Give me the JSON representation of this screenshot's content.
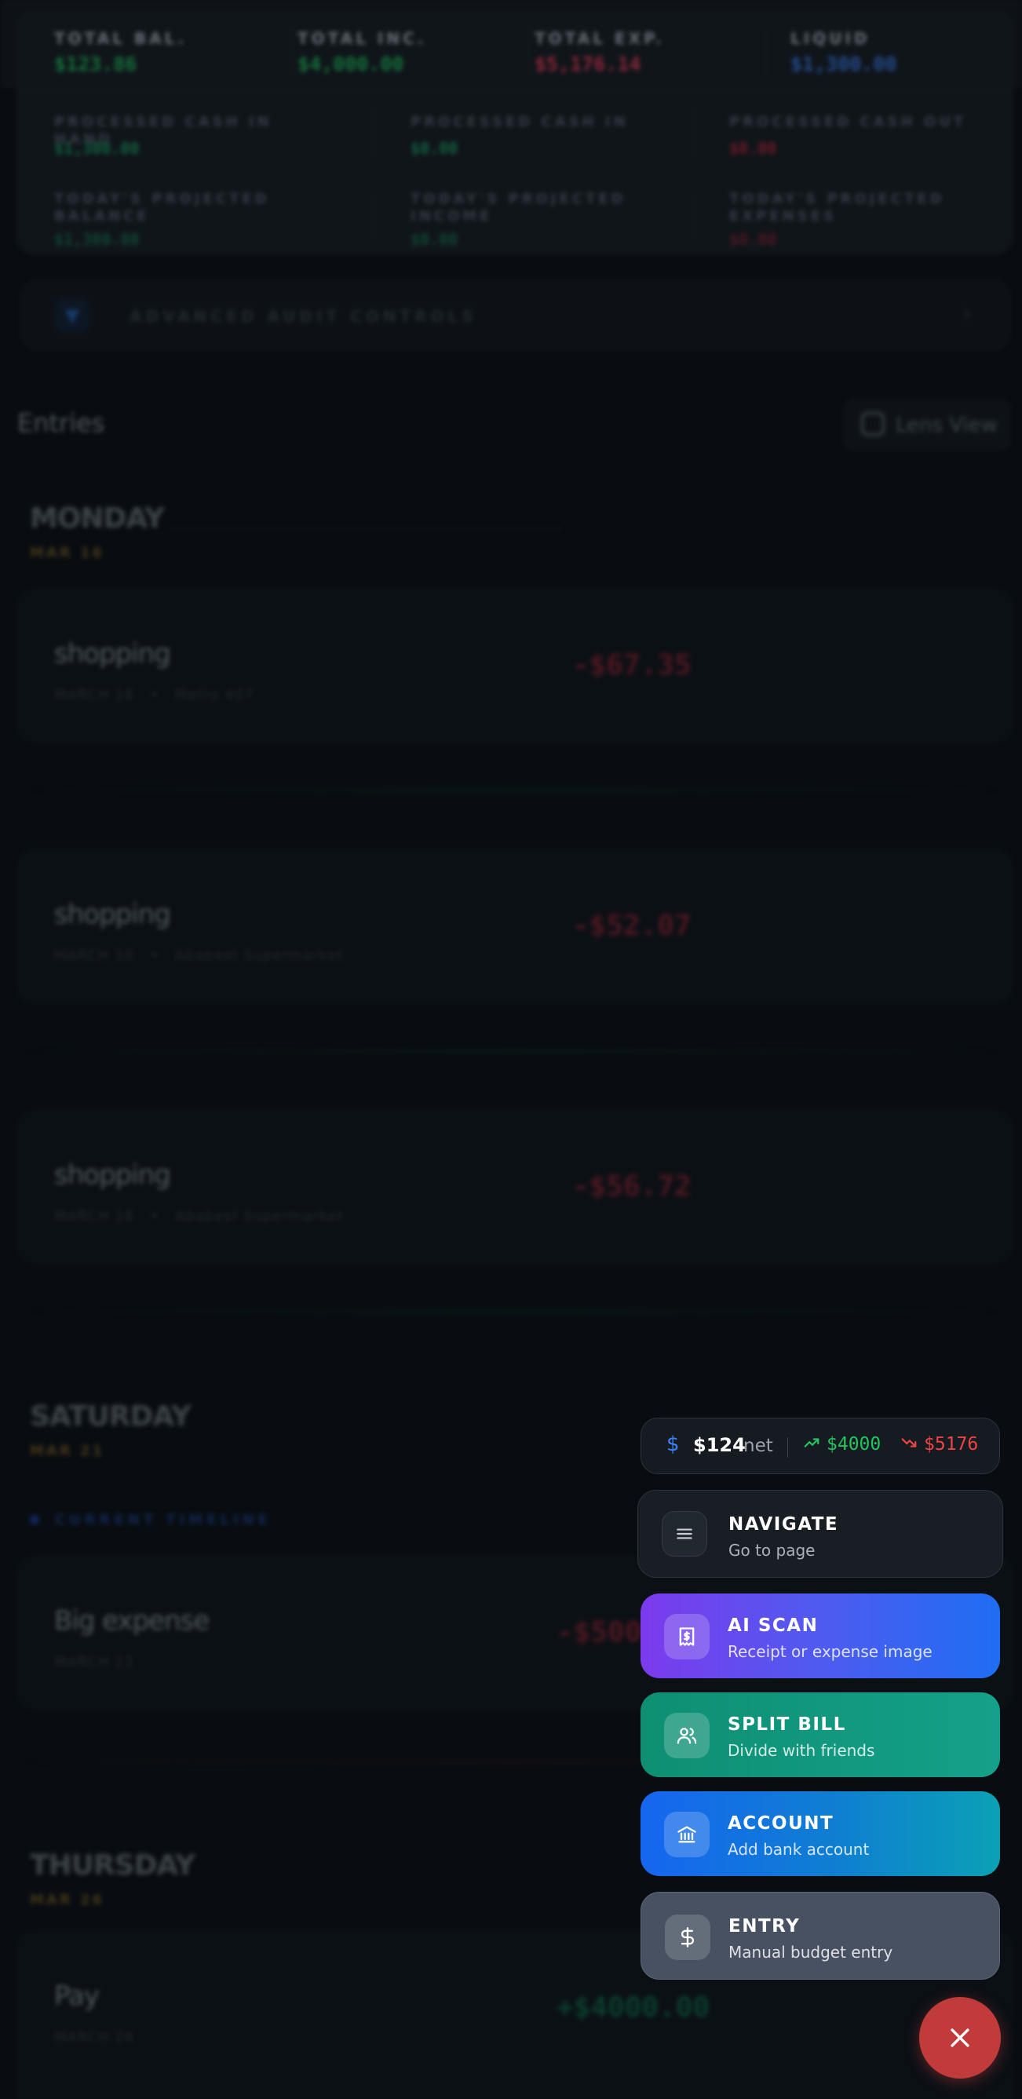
{
  "summary": {
    "row1": [
      {
        "label": "TOTAL BAL.",
        "value": "$123.86",
        "color": "#22c55e"
      },
      {
        "label": "TOTAL INC.",
        "value": "$4,000.00",
        "color": "#22c55e"
      },
      {
        "label": "TOTAL EXP.",
        "value": "$5,176.14",
        "color": "#f43f5e"
      },
      {
        "label": "LIQUID",
        "value": "$1,300.00",
        "color": "#3b82f6"
      }
    ],
    "row2": [
      {
        "label": "PROCESSED CASH IN HAND",
        "value": "$1,300.00",
        "color": "#1fa56a"
      },
      {
        "label": "PROCESSED CASH IN",
        "value": "$0.00",
        "color": "#1fa56a"
      },
      {
        "label": "PROCESSED CASH OUT",
        "value": "$0.00",
        "color": "#c0283d"
      }
    ],
    "row3": [
      {
        "label": "TODAY'S PROJECTED BALANCE",
        "value": "$1,300.00",
        "color": "#1fa56a"
      },
      {
        "label": "TODAY'S PROJECTED INCOME",
        "value": "$0.00",
        "color": "#1fa56a"
      },
      {
        "label": "TODAY'S PROJECTED EXPENSES",
        "value": "$0.00",
        "color": "#c0283d"
      }
    ]
  },
  "audit": {
    "label": "ADVANCED AUDIT CONTROLS"
  },
  "entries": {
    "title": "Entries",
    "lens_label": "Lens View",
    "current_timeline_label": "CURRENT TIMELINE",
    "days": [
      {
        "day": "MONDAY",
        "date": "MAR 16"
      },
      {
        "day": "SATURDAY",
        "date": "MAR 21"
      },
      {
        "day": "THURSDAY",
        "date": "MAR 26"
      }
    ],
    "items": [
      {
        "title": "shopping",
        "date": "MARCH 16",
        "place": "Metro 407",
        "amount": "-$67.35"
      },
      {
        "title": "shopping",
        "date": "MARCH 16",
        "place": "Ababeel Supermarket",
        "amount": "-$52.07"
      },
      {
        "title": "shopping",
        "date": "MARCH 16",
        "place": "Ababeel Supermarket",
        "amount": "-$56.72"
      },
      {
        "title": "Big expense",
        "date": "MARCH 21",
        "place": "",
        "amount": "-$5000"
      },
      {
        "title": "Pay",
        "date": "MARCH 26",
        "place": "",
        "amount": "+$4000.00"
      }
    ]
  },
  "net_pill": {
    "net_value": "$124",
    "net_label": "net",
    "income": "$4000",
    "expense": "$5176"
  },
  "menu": {
    "navigate": {
      "title": "NAVIGATE",
      "subtitle": "Go to page",
      "icon": "menu-lines-icon"
    },
    "ai_scan": {
      "title": "AI SCAN",
      "subtitle": "Receipt or expense image",
      "icon": "receipt-icon"
    },
    "split_bill": {
      "title": "SPLIT BILL",
      "subtitle": "Divide with friends",
      "icon": "users-icon"
    },
    "account": {
      "title": "ACCOUNT",
      "subtitle": "Add bank account",
      "icon": "bank-icon"
    },
    "entry": {
      "title": "ENTRY",
      "subtitle": "Manual budget entry",
      "icon": "dollar-icon"
    }
  },
  "colors": {
    "accent_red": "#c23b3b",
    "income_green": "#22c55e",
    "expense_red": "#ef4444",
    "accent_blue": "#3b82f6"
  }
}
